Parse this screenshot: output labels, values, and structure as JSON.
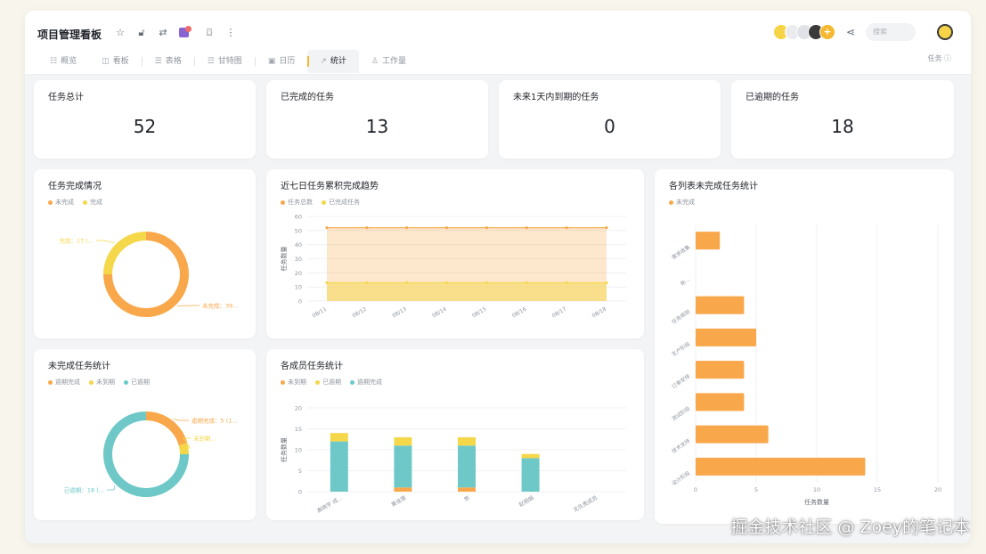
{
  "app": {
    "title": "项目管理看板",
    "tabs": [
      {
        "label": "概览",
        "icon": "grid-icon"
      },
      {
        "label": "看板",
        "icon": "kanban-icon"
      },
      {
        "label": "表格",
        "icon": "table-icon"
      },
      {
        "label": "甘特图",
        "icon": "gantt-icon"
      },
      {
        "label": "日历",
        "icon": "calendar-icon"
      },
      {
        "label": "统计",
        "icon": "chart-icon"
      },
      {
        "label": "工作量",
        "icon": "workload-icon"
      }
    ],
    "active_tab": "统计",
    "avatars": [
      "",
      "",
      "",
      ""
    ],
    "search_placeholder": "搜索",
    "task_help": "任务 ⓘ"
  },
  "stats": [
    {
      "label": "任务总计",
      "value": "52"
    },
    {
      "label": "已完成的任务",
      "value": "13"
    },
    {
      "label": "未来1天内到期的任务",
      "value": "0"
    },
    {
      "label": "已逾期的任务",
      "value": "18"
    }
  ],
  "panels": {
    "completion": {
      "title": "任务完成情况",
      "legend": [
        "未完成",
        "完成"
      ]
    },
    "trend": {
      "title": "近七日任务累积完成趋势",
      "legend": [
        "任务总数",
        "已完成任务"
      ]
    },
    "incomplete": {
      "title": "未完成任务统计",
      "legend": [
        "逾期完成",
        "未到期",
        "已逾期"
      ]
    },
    "members": {
      "title": "各成员任务统计",
      "legend": [
        "未到期",
        "已逾期",
        "逾期完成"
      ]
    },
    "lists": {
      "title": "各列表未完成任务统计",
      "legend": [
        "未完成"
      ]
    }
  },
  "colors": {
    "orange": "#f8a84a",
    "yellow": "#f5d74a",
    "teal": "#6ec8c8",
    "accent": "#f5b82e"
  },
  "chart_data": [
    {
      "type": "pie",
      "title": "任务完成情况",
      "series": [
        {
          "name": "未完成",
          "value": 39,
          "label": "未完成：39..."
        },
        {
          "name": "完成",
          "value": 13,
          "label": "完成：13 (..."
        }
      ]
    },
    {
      "type": "area",
      "title": "近七日任务累积完成趋势",
      "ylabel": "任务数量",
      "ylim": [
        0,
        60
      ],
      "yticks": [
        0,
        10,
        20,
        30,
        40,
        50,
        60
      ],
      "categories": [
        "08/11",
        "08/12",
        "08/13",
        "08/14",
        "08/15",
        "08/16",
        "08/17",
        "08/18"
      ],
      "series": [
        {
          "name": "任务总数",
          "values": [
            52,
            52,
            52,
            52,
            52,
            52,
            52,
            52
          ]
        },
        {
          "name": "已完成任务",
          "values": [
            13,
            13,
            13,
            13,
            13,
            13,
            13,
            13
          ]
        }
      ]
    },
    {
      "type": "pie",
      "title": "未完成任务统计",
      "series": [
        {
          "name": "逾期完成",
          "value": 5,
          "label": "逾期完成：5 (1..."
        },
        {
          "name": "未到期",
          "value": 1,
          "label": "未到期..."
        },
        {
          "name": "已逾期",
          "value": 18,
          "label": "已逾期：18 (..."
        }
      ]
    },
    {
      "type": "bar",
      "title": "各成员任务统计",
      "ylabel": "任务数量",
      "ylim": [
        0,
        20
      ],
      "yticks": [
        0,
        5,
        10,
        15,
        20
      ],
      "categories": [
        "高晓宇 成...",
        "黄佳慧",
        "陈",
        "赵丽娟",
        "无负责成员"
      ],
      "series": [
        {
          "name": "逾期完成",
          "values": [
            0,
            1,
            1,
            0,
            0
          ]
        },
        {
          "name": "已逾期",
          "values": [
            12,
            10,
            10,
            8,
            0
          ]
        },
        {
          "name": "未到期",
          "values": [
            2,
            2,
            2,
            1,
            0
          ]
        }
      ]
    },
    {
      "type": "bar",
      "orientation": "horizontal",
      "title": "各列表未完成任务统计",
      "xlabel": "任务数量",
      "xlim": [
        0,
        20
      ],
      "xticks": [
        0,
        5,
        10,
        15,
        20
      ],
      "categories": [
        "需求收集",
        "新...",
        "任务规划",
        "生产阶段",
        "订单安排",
        "测试阶段",
        "技术支持",
        "设计阶段"
      ],
      "series": [
        {
          "name": "未完成",
          "values": [
            2,
            0,
            4,
            5,
            4,
            4,
            6,
            14
          ]
        }
      ]
    }
  ],
  "watermark": "掘金技术社区 @ Zoey的笔记本"
}
